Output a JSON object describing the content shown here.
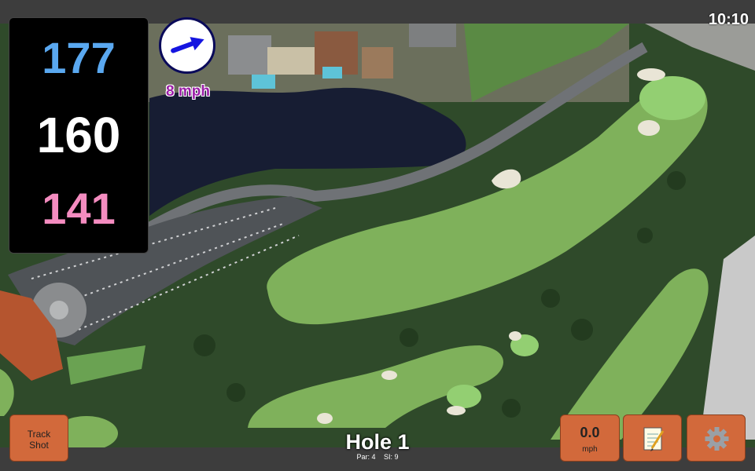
{
  "clock": "10:10",
  "yardage": {
    "back": "177",
    "middle": "160",
    "front": "141"
  },
  "wind": {
    "speed": "8 mph",
    "icon": "wind-direction-arrow-icon"
  },
  "hole": {
    "title": "Hole 1",
    "par": "Par: 4",
    "stroke_index": "SI: 9"
  },
  "buttons": {
    "track_shot_line1": "Track",
    "track_shot_line2": "Shot",
    "speed_value": "0.0",
    "speed_unit": "mph",
    "notes_icon": "notepad-icon",
    "settings_icon": "gear-icon"
  },
  "colors": {
    "back": "#5aa8f0",
    "middle": "#ffffff",
    "front": "#f48cc0",
    "button": "#d2693b",
    "wind_text": "#9b1fa8"
  }
}
